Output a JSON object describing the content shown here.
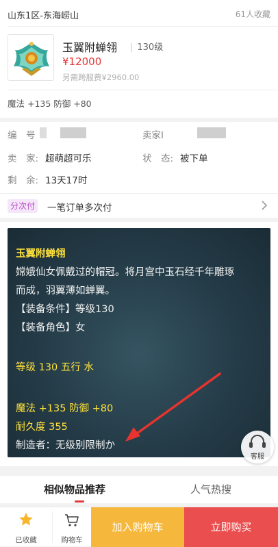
{
  "header": {
    "server": "山东1区-东海崂山",
    "favorites": "61人收藏"
  },
  "item": {
    "name": "玉翼附蝉翎",
    "level": "130级",
    "price": "¥12000",
    "extra_fee": "另需跨服费¥2960.00",
    "stats": "魔法 +135 防御 +80"
  },
  "info": {
    "id_label": "编　号",
    "seller_id_label": "卖家I",
    "seller_label": "卖　家:",
    "seller_value": "超萌超可乐",
    "status_label": "状　态:",
    "status_value": "被下单",
    "remaining_label": "剩　余:",
    "remaining_value": "13天17时"
  },
  "payment": {
    "badge": "分次付",
    "text": "一笔订单多次付"
  },
  "description": {
    "title": "玉翼附蝉翎",
    "line1": "嫦娥仙女佩戴过的帽冠。将月宫中玉石经千年雕琢",
    "line2": "而成，羽翼薄如蝉翼。",
    "line3": "【装备条件】等级130",
    "line4": "【装备角色】女",
    "line5": "等级 130 五行 水",
    "line6": "魔法 +135 防御 +80",
    "line7": "耐久度 355",
    "line8": "制造者：无级别限制か"
  },
  "customer_service": "客服",
  "tabs": [
    "相似物品推荐",
    "人气热搜"
  ],
  "bottom_bar": {
    "favorited": "已收藏",
    "cart": "购物车",
    "add_to_cart": "加入购物车",
    "buy_now": "立即购买"
  },
  "colors": {
    "price": "#e4393c",
    "yellow_text": "#ffe23b",
    "cart_button": "#f6b83c",
    "buy_button": "#ea4e4e",
    "annotation_arrow": "#e8332e"
  }
}
